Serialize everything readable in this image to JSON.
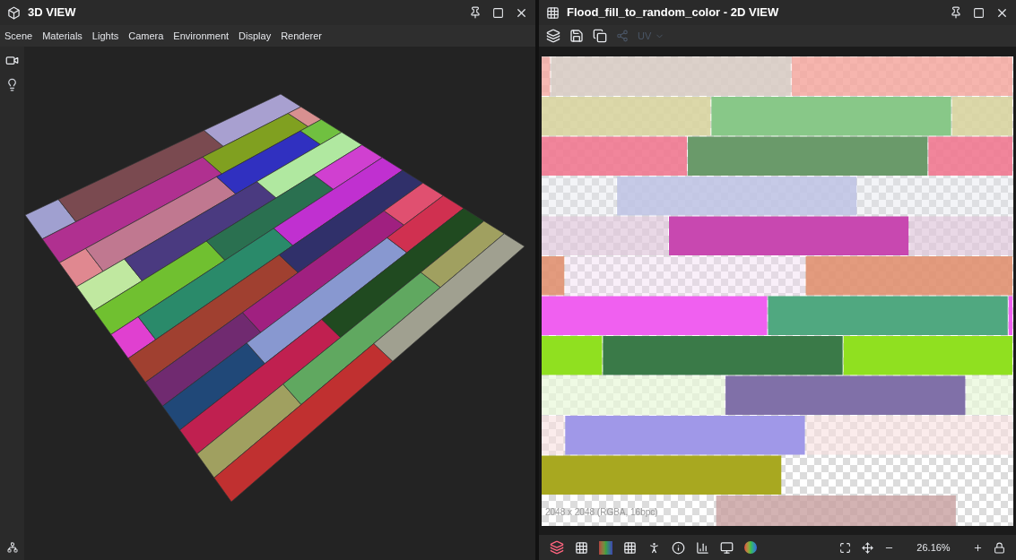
{
  "view_3d": {
    "title": "3D VIEW",
    "menu": [
      {
        "label": "Scene"
      },
      {
        "label": "Materials"
      },
      {
        "label": "Lights"
      },
      {
        "label": "Camera"
      },
      {
        "label": "Environment"
      },
      {
        "label": "Display"
      },
      {
        "label": "Renderer"
      }
    ]
  },
  "view_2d": {
    "title": "Flood_fill_to_random_color - 2D VIEW",
    "uv_dropdown": {
      "label": "UV",
      "disabled": true
    },
    "texture_info": "2048 x 2048 (RGBA, 16bpc)",
    "zoom": "26.16%"
  }
}
